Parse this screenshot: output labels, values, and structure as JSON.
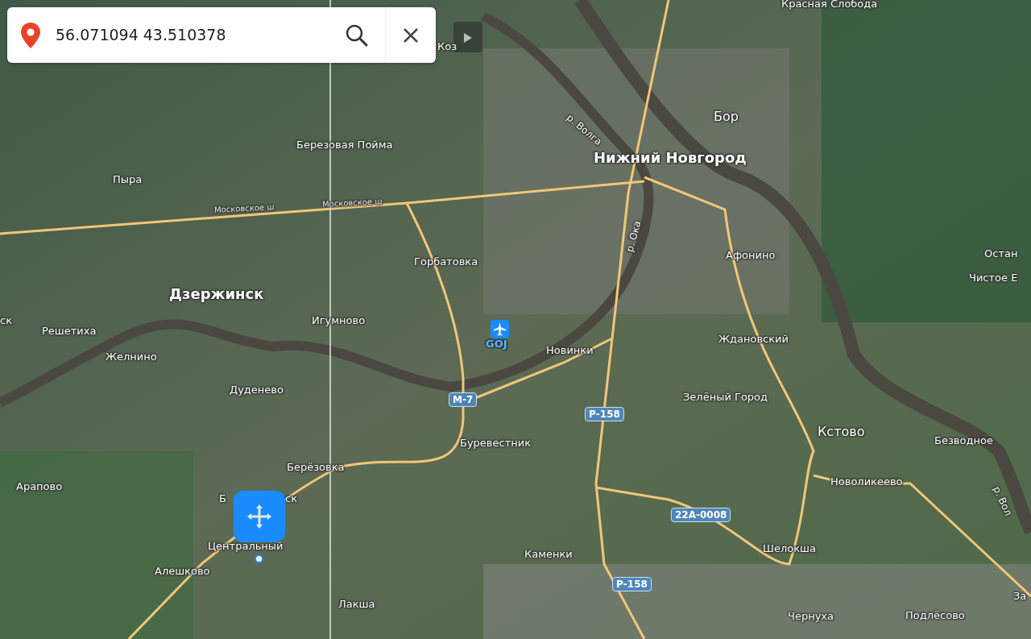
{
  "search": {
    "value": "56.071094 43.510378"
  },
  "map": {
    "places": [
      {
        "name": "Красная Слобода",
        "kind": "village"
      },
      {
        "name": "Коз",
        "kind": "village"
      },
      {
        "name": "Березовая Пойма",
        "kind": "village"
      },
      {
        "name": "Пыра",
        "kind": "village"
      },
      {
        "name": "Нижний Новгород",
        "kind": "city"
      },
      {
        "name": "Бор",
        "kind": "town"
      },
      {
        "name": "р. Волга",
        "kind": "river"
      },
      {
        "name": "Московское ш",
        "kind": "street"
      },
      {
        "name": "Московское ш",
        "kind": "street"
      },
      {
        "name": "Горбатовка",
        "kind": "village"
      },
      {
        "name": "Дзержинск",
        "kind": "city"
      },
      {
        "name": "р. Ока",
        "kind": "river"
      },
      {
        "name": "Афонино",
        "kind": "village"
      },
      {
        "name": "Остан",
        "kind": "village"
      },
      {
        "name": "Чистое Е",
        "kind": "village"
      },
      {
        "name": "ск",
        "kind": "village"
      },
      {
        "name": "Решетиха",
        "kind": "village"
      },
      {
        "name": "Игумново",
        "kind": "village"
      },
      {
        "name": "GOJ",
        "kind": "airport"
      },
      {
        "name": "Желнино",
        "kind": "village"
      },
      {
        "name": "Новинки",
        "kind": "village"
      },
      {
        "name": "Ждановский",
        "kind": "village"
      },
      {
        "name": "Дуденево",
        "kind": "village"
      },
      {
        "name": "М-7",
        "kind": "shield"
      },
      {
        "name": "Зелёный Город",
        "kind": "village"
      },
      {
        "name": "Р-158",
        "kind": "shield"
      },
      {
        "name": "Буревестник",
        "kind": "village"
      },
      {
        "name": "Кстово",
        "kind": "town"
      },
      {
        "name": "Безводное",
        "kind": "village"
      },
      {
        "name": "р. Вол",
        "kind": "river"
      },
      {
        "name": "Берёзовка",
        "kind": "village"
      },
      {
        "name": "Арапово",
        "kind": "village"
      },
      {
        "name": "Новоликеево",
        "kind": "village"
      },
      {
        "name": "Б",
        "kind": "village"
      },
      {
        "name": "ск",
        "kind": "village"
      },
      {
        "name": "22А-0008",
        "kind": "shield"
      },
      {
        "name": "Центральный",
        "kind": "village"
      },
      {
        "name": "Алешково",
        "kind": "village"
      },
      {
        "name": "Каменки",
        "kind": "village"
      },
      {
        "name": "Шелокша",
        "kind": "village"
      },
      {
        "name": "Р-158",
        "kind": "shield"
      },
      {
        "name": "За",
        "kind": "village"
      },
      {
        "name": "Лакша",
        "kind": "village"
      },
      {
        "name": "Чернуха",
        "kind": "village"
      },
      {
        "name": "Подлёсово",
        "kind": "village"
      }
    ]
  }
}
